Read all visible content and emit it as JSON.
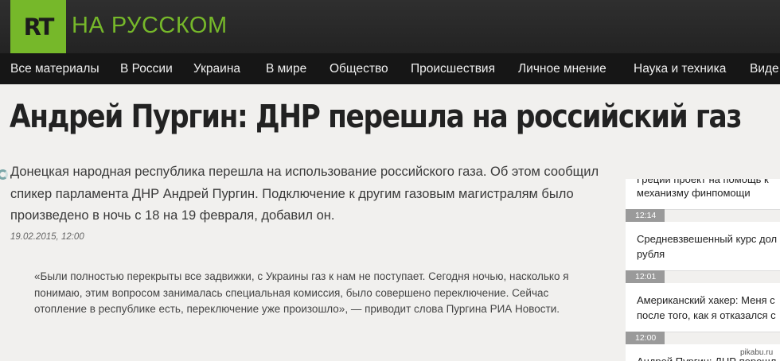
{
  "header": {
    "logo_text": "RT",
    "site_name": "НА РУССКОМ",
    "brand_color": "#76b82a"
  },
  "nav": {
    "items": [
      "Все материалы",
      "В России",
      "Украина",
      "В мире",
      "Общество",
      "Происшествия",
      "Личное мнение",
      "Наука и техника",
      "Виде"
    ]
  },
  "article": {
    "headline": "Андрей Пургин: ДНР перешла на российский газ",
    "lead": "Донецкая народная республика перешла на использование российского газа. Об этом сообщил спикер парламента ДНР Андрей Пургин. Подключение к другим газовым магистралям было произведено в ночь с 18 на 19 февраля, добавил он.",
    "date": "19.02.2015, 12:00",
    "quote": "«Были полностью перекрыты все задвижки, с Украины газ к нам не поступает. Сегодня ночью, насколько я понимаю, этим вопросом занималась специальная комиссия, было совершено переключение. Сейчас отопление в республике есть, переключение уже произошло», — приводит слова Пургина РИА Новости."
  },
  "sidebar": {
    "items": [
      {
        "time": "",
        "line1": "Греции проект на помощь к",
        "line2": "механизму финпомощи"
      },
      {
        "time": "12:14",
        "line1": "Средневзвешенный курс дол",
        "line2": "рубля"
      },
      {
        "time": "12:01",
        "line1": "Американский хакер: Меня с",
        "line2": "после того, как я отказался с"
      },
      {
        "time": "12:00",
        "line1": "Андрей Пургин: ДНР перешл",
        "line2": ""
      }
    ]
  },
  "watermark": "pikabu.ru"
}
